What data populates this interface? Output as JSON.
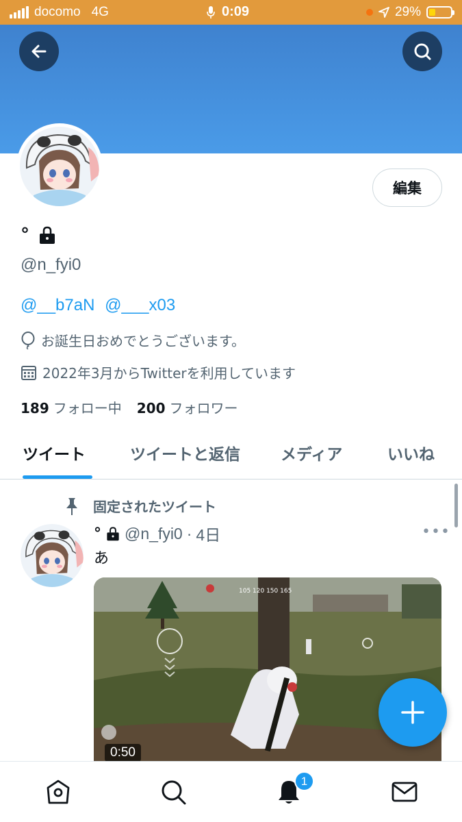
{
  "status_bar": {
    "carrier": "docomo",
    "network": "4G",
    "time": "0:09",
    "battery": "29%",
    "battery_level": 0.29
  },
  "header": {
    "back_icon": "arrow-left-icon",
    "search_icon": "search-icon"
  },
  "profile": {
    "display_name": "°",
    "locked": true,
    "handle": "@n_fyi0",
    "edit_label": "編集",
    "bio_mentions": [
      "@__b7aN",
      "@___x03"
    ],
    "birthday": "お誕生日おめでとうございます。",
    "joined": "2022年3月からTwitterを利用しています",
    "following_count": "189",
    "following_label": "フォロー中",
    "followers_count": "200",
    "followers_label": "フォロワー"
  },
  "tabs": [
    {
      "label": "ツイート",
      "active": true
    },
    {
      "label": "ツイートと返信",
      "active": false
    },
    {
      "label": "メディア",
      "active": false
    },
    {
      "label": "いいね",
      "active": false
    }
  ],
  "tweet": {
    "pinned_label": "固定されたツイート",
    "author_name": "°",
    "author_handle": "@n_fyi0",
    "time": "4日",
    "text": "あ",
    "video_duration": "0:50"
  },
  "bottom_nav": {
    "notification_count": "1",
    "items": [
      "home-icon",
      "search-icon",
      "bell-icon",
      "mail-icon"
    ]
  },
  "colors": {
    "accent": "#1d9bf0",
    "status_bar": "#e29a3c",
    "banner": "#4a9be8"
  }
}
